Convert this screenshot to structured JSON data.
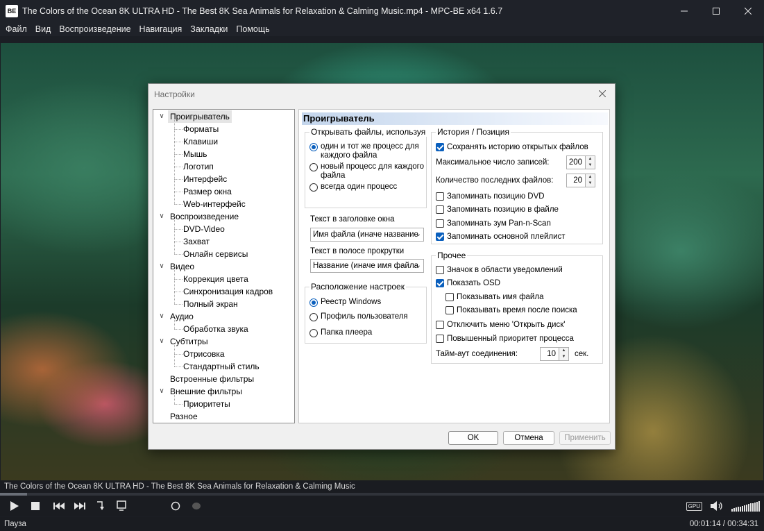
{
  "window": {
    "title": "The Colors of the Ocean 8K ULTRA HD - The Best 8K Sea Animals for Relaxation & Calming Music.mp4 - MPC-BE x64 1.6.7",
    "icon_label": "BE"
  },
  "menu": [
    "Файл",
    "Вид",
    "Воспроизведение",
    "Навигация",
    "Закладки",
    "Помощь"
  ],
  "dialog": {
    "title": "Настройки",
    "tree": [
      {
        "label": "Проигрыватель",
        "level": 0,
        "expanded": true,
        "selected": true
      },
      {
        "label": "Форматы",
        "level": 1
      },
      {
        "label": "Клавиши",
        "level": 1
      },
      {
        "label": "Мышь",
        "level": 1
      },
      {
        "label": "Логотип",
        "level": 1
      },
      {
        "label": "Интерфейс",
        "level": 1
      },
      {
        "label": "Размер окна",
        "level": 1
      },
      {
        "label": "Web-интерфейс",
        "level": 1
      },
      {
        "label": "Воспроизведение",
        "level": 0,
        "expanded": true
      },
      {
        "label": "DVD-Video",
        "level": 1
      },
      {
        "label": "Захват",
        "level": 1
      },
      {
        "label": "Онлайн сервисы",
        "level": 1
      },
      {
        "label": "Видео",
        "level": 0,
        "expanded": true
      },
      {
        "label": "Коррекция цвета",
        "level": 1
      },
      {
        "label": "Синхронизация кадров",
        "level": 1
      },
      {
        "label": "Полный экран",
        "level": 1
      },
      {
        "label": "Аудио",
        "level": 0,
        "expanded": true
      },
      {
        "label": "Обработка звука",
        "level": 1
      },
      {
        "label": "Субтитры",
        "level": 0,
        "expanded": true
      },
      {
        "label": "Отрисовка",
        "level": 1
      },
      {
        "label": "Стандартный стиль",
        "level": 1
      },
      {
        "label": "Встроенные фильтры",
        "level": 0
      },
      {
        "label": "Внешние фильтры",
        "level": 0,
        "expanded": true
      },
      {
        "label": "Приоритеты",
        "level": 1
      },
      {
        "label": "Разное",
        "level": 0
      }
    ],
    "panel_title": "Проигрыватель",
    "open_files": {
      "legend": "Открывать файлы, используя",
      "opt1": "один и тот же процесс для каждого файла",
      "opt2": "новый процесс для каждого файла",
      "opt3": "всегда один процесс"
    },
    "window_title_label": "Текст в заголовке окна",
    "window_title_value": "Имя файла (иначе название",
    "seekbar_label": "Текст в полосе прокрутки",
    "seekbar_value": "Название (иначе имя файла",
    "settings_location": {
      "legend": "Расположение настроек",
      "opt1": "Реестр Windows",
      "opt2": "Профиль пользователя",
      "opt3": "Папка плеера"
    },
    "history": {
      "legend": "История / Позиция",
      "save_history": "Сохранять историю открытых файлов",
      "max_records_label": "Максимальное число записей:",
      "max_records_value": "200",
      "recent_files_label": "Количество последних файлов:",
      "recent_files_value": "20",
      "remember_dvd": "Запоминать позицию DVD",
      "remember_file": "Запоминать позицию в файле",
      "remember_zoom": "Запоминать зум Pan-n-Scan",
      "remember_playlist": "Запоминать основной плейлист"
    },
    "misc": {
      "legend": "Прочее",
      "tray_icon": "Значок в области уведомлений",
      "show_osd": "Показать OSD",
      "show_filename": "Показывать имя файла",
      "show_time_after_seek": "Показывать время после поиска",
      "disable_open_disc": "Отключить меню 'Открыть диск'",
      "high_priority": "Повышенный приоритет процесса",
      "timeout_label": "Тайм-аут соединения:",
      "timeout_value": "10",
      "timeout_unit": "сек."
    },
    "buttons": {
      "ok": "OK",
      "cancel": "Отмена",
      "apply": "Применить"
    }
  },
  "player": {
    "filename": "The Colors of the Ocean 8K ULTRA HD - The Best 8K Sea Animals for Relaxation & Calming Music",
    "status": "Пауза",
    "time": "00:01:14 / 00:34:31",
    "progress": 0.0357,
    "gpu_label": "GPU"
  }
}
